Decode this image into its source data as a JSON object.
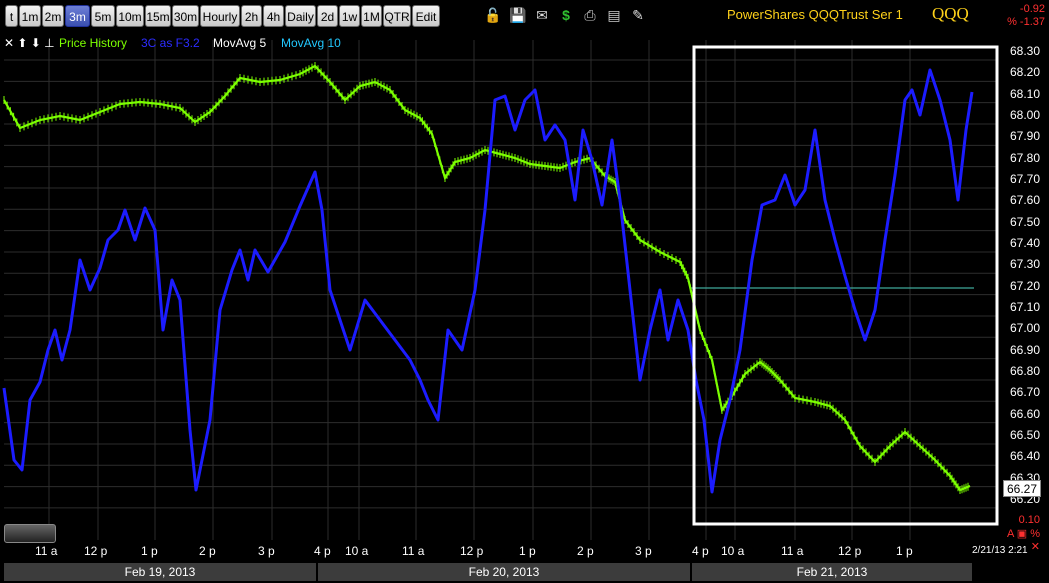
{
  "toolbar": {
    "buttons": [
      "t",
      "1m",
      "2m",
      "3m",
      "5m",
      "10m",
      "15m",
      "30m",
      "Hourly",
      "2h",
      "4h",
      "Daily",
      "2d",
      "1w",
      "1M",
      "QTR",
      "Edit"
    ],
    "active": "3m",
    "icons": [
      "lock-icon",
      "save-icon",
      "email-icon",
      "dollar-icon",
      "print-icon",
      "card-icon",
      "pencil-icon"
    ]
  },
  "header": {
    "title": "PowerShares QQQTrust Ser 1",
    "symbol": "QQQ",
    "change": "-0.92",
    "change_pct": "% -1.37"
  },
  "legend": {
    "arrows": "✕ ⬆ ⬇ ⊥",
    "items": [
      {
        "label": "Price History",
        "color": "#7cff00"
      },
      {
        "label": "3C as F3.2",
        "color": "#2c2cff"
      },
      {
        "label": "MovAvg 5",
        "color": "#ffffff"
      },
      {
        "label": "MovAvg 10",
        "color": "#22c8ff"
      }
    ]
  },
  "yaxis": {
    "labels": [
      "68.30",
      "68.20",
      "68.10",
      "68.00",
      "67.90",
      "67.80",
      "67.70",
      "67.60",
      "67.50",
      "67.40",
      "67.30",
      "67.20",
      "67.10",
      "67.00",
      "66.90",
      "66.80",
      "66.70",
      "66.60",
      "66.50",
      "66.40",
      "66.30",
      "66.20"
    ],
    "current_price": "66.27",
    "bottom_value": "0.10"
  },
  "xaxis": {
    "ticks": [
      "11 a",
      "12 p",
      "1 p",
      "2 p",
      "3 p",
      "4 p",
      "10 a",
      "11 a",
      "12 p",
      "1 p",
      "2 p",
      "3 p",
      "4 p",
      "10 a",
      "11 a",
      "12 p",
      "1 p"
    ],
    "dates": [
      "Feb 19, 2013",
      "Feb 20, 2013",
      "Feb 21, 2013"
    ],
    "timestamp": "2/21/13 2:21",
    "bottom_icons": "A ▣ % ✕"
  },
  "colors": {
    "price": "#7cff00",
    "indicator": "#1c1cff",
    "hline": "#3fa89a",
    "grid": "#2d2d2d",
    "highlight": "#ffffff"
  }
}
